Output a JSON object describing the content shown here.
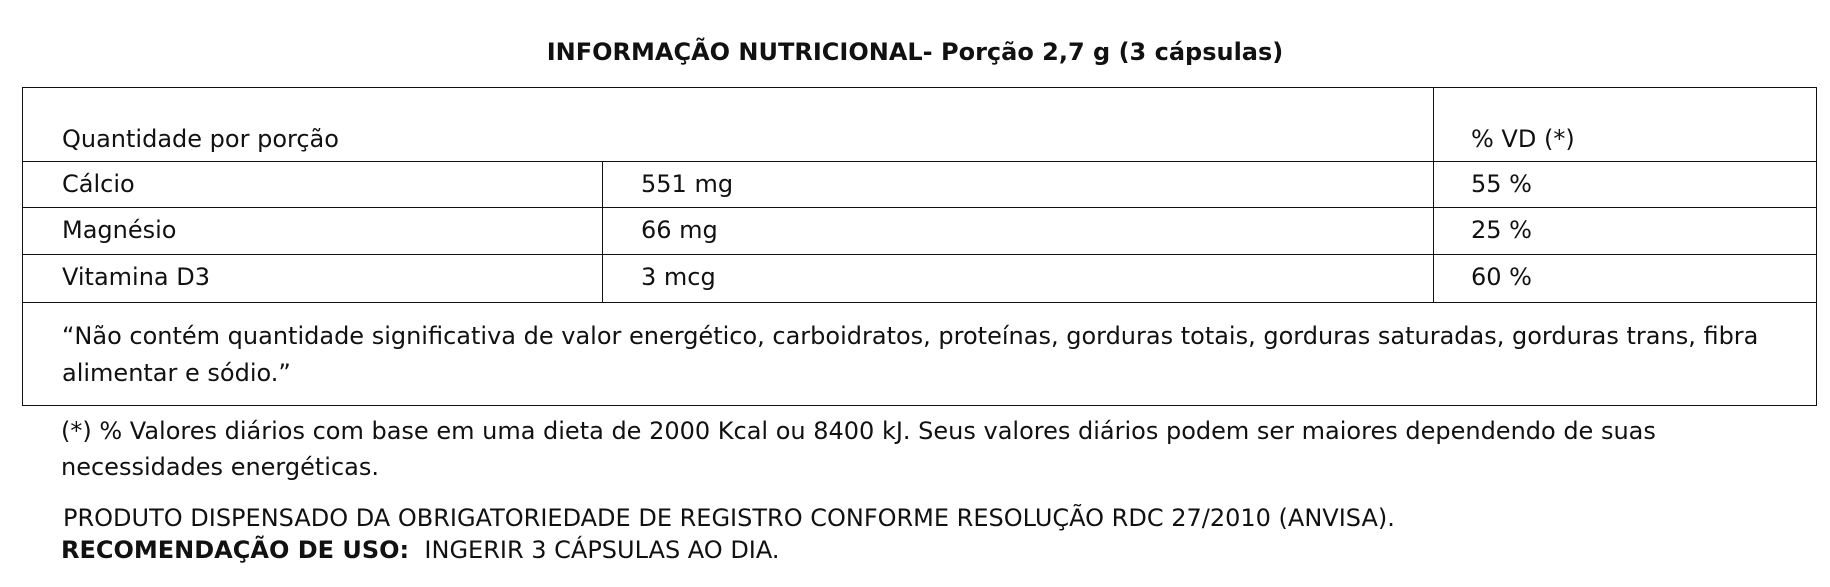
{
  "title": "INFORMAÇÃO NUTRICIONAL- Porção 2,7 g (3 cápsulas)",
  "table": {
    "header_left": "Quantidade por porção",
    "header_right": "% VD (*)",
    "rows": [
      {
        "nutrient": "Cálcio",
        "amount": "551 mg",
        "vd": "55 %"
      },
      {
        "nutrient": "Magnésio",
        "amount": "66 mg",
        "vd": "25 %"
      },
      {
        "nutrient": "Vitamina D3",
        "amount": "3 mcg",
        "vd": "60 %"
      }
    ],
    "note": "“Não contém quantidade significativa de valor energético, carboidratos, proteínas, gorduras totais, gorduras saturadas, gorduras trans, fibra alimentar e sódio.”"
  },
  "footnote": "(*) % Valores diários com base em uma dieta de 2000 Kcal ou 8400 kJ. Seus valores diários podem ser maiores dependendo de suas necessidades energéticas.",
  "registration": "PRODUTO DISPENSADO DA OBRIGATORIEDADE DE REGISTRO CONFORME RESOLUÇÃO RDC 27/2010 (ANVISA).",
  "recommendation_label": "RECOMENDAÇÃO DE USO:",
  "recommendation_text": "INGERIR 3 CÁPSULAS AO DIA."
}
